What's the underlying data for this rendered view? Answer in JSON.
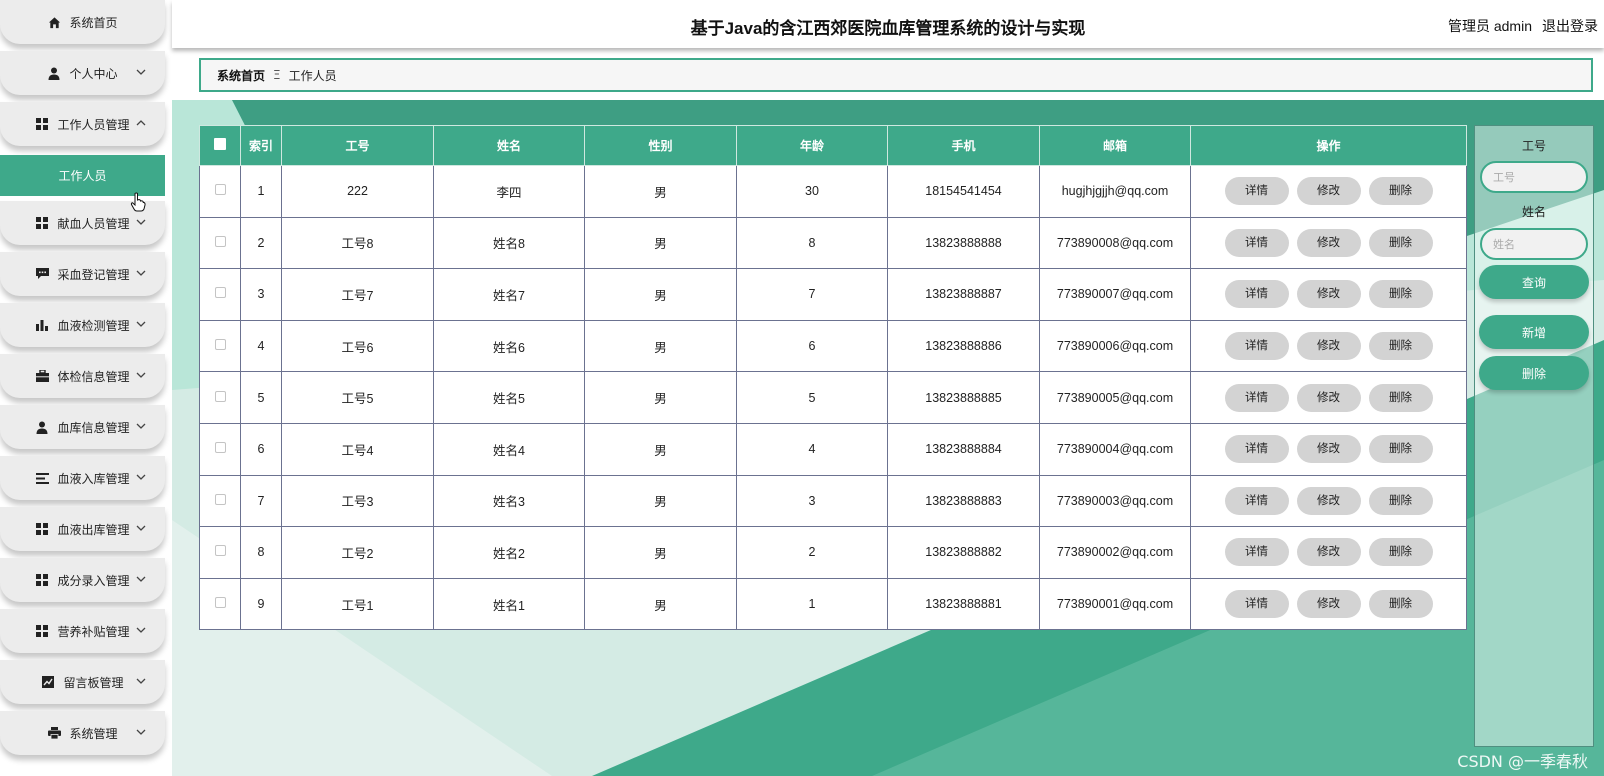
{
  "app": {
    "title": "基于Java的含江西郊医院血库管理系统的设计与实现",
    "user_label": "管理员 admin",
    "logout_label": "退出登录"
  },
  "sidebar": {
    "items": [
      {
        "label": "系统首页",
        "icon": "home-icon"
      },
      {
        "label": "个人中心",
        "icon": "person-icon"
      },
      {
        "label": "工作人员管理",
        "icon": "grid-icon"
      },
      {
        "label": "献血人员管理",
        "icon": "grid-icon"
      },
      {
        "label": "采血登记管理",
        "icon": "chat-icon"
      },
      {
        "label": "血液检测管理",
        "icon": "bar-chart-icon"
      },
      {
        "label": "体检信息管理",
        "icon": "briefcase-icon"
      },
      {
        "label": "血库信息管理",
        "icon": "person-icon"
      },
      {
        "label": "血液入库管理",
        "icon": "list-icon"
      },
      {
        "label": "血液出库管理",
        "icon": "grid-icon"
      },
      {
        "label": "成分录入管理",
        "icon": "grid-icon"
      },
      {
        "label": "营养补贴管理",
        "icon": "grid-icon"
      },
      {
        "label": "留言板管理",
        "icon": "trend-icon"
      },
      {
        "label": "系统管理",
        "icon": "printer-icon"
      }
    ],
    "active_sub_item": "工作人员"
  },
  "breadcrumb": {
    "home": "系统首页",
    "separator": "Ξ",
    "current": "工作人员"
  },
  "table": {
    "columns": [
      "索引",
      "工号",
      "姓名",
      "性别",
      "年龄",
      "手机",
      "邮箱",
      "操作"
    ],
    "action_labels": {
      "detail": "详情",
      "edit": "修改",
      "delete": "删除"
    },
    "rows": [
      {
        "index": "1",
        "staff_no": "222",
        "name": "李四",
        "gender": "男",
        "age": "30",
        "phone": "18154541454",
        "email": "hugjhjgjjh@qq.com"
      },
      {
        "index": "2",
        "staff_no": "工号8",
        "name": "姓名8",
        "gender": "男",
        "age": "8",
        "phone": "13823888888",
        "email": "773890008@qq.com"
      },
      {
        "index": "3",
        "staff_no": "工号7",
        "name": "姓名7",
        "gender": "男",
        "age": "7",
        "phone": "13823888887",
        "email": "773890007@qq.com"
      },
      {
        "index": "4",
        "staff_no": "工号6",
        "name": "姓名6",
        "gender": "男",
        "age": "6",
        "phone": "13823888886",
        "email": "773890006@qq.com"
      },
      {
        "index": "5",
        "staff_no": "工号5",
        "name": "姓名5",
        "gender": "男",
        "age": "5",
        "phone": "13823888885",
        "email": "773890005@qq.com"
      },
      {
        "index": "6",
        "staff_no": "工号4",
        "name": "姓名4",
        "gender": "男",
        "age": "4",
        "phone": "13823888884",
        "email": "773890004@qq.com"
      },
      {
        "index": "7",
        "staff_no": "工号3",
        "name": "姓名3",
        "gender": "男",
        "age": "3",
        "phone": "13823888883",
        "email": "773890003@qq.com"
      },
      {
        "index": "8",
        "staff_no": "工号2",
        "name": "姓名2",
        "gender": "男",
        "age": "2",
        "phone": "13823888882",
        "email": "773890002@qq.com"
      },
      {
        "index": "9",
        "staff_no": "工号1",
        "name": "姓名1",
        "gender": "男",
        "age": "1",
        "phone": "13823888881",
        "email": "773890001@qq.com"
      }
    ]
  },
  "search": {
    "staff_no_label": "工号",
    "staff_no_placeholder": "工号",
    "name_label": "姓名",
    "name_placeholder": "姓名",
    "query_label": "查询",
    "add_label": "新增",
    "delete_label": "删除"
  },
  "watermark": "CSDN @一季春秋",
  "colors": {
    "accent": "#3ea98a",
    "sidebar_item": "#ececec",
    "action_button": "#d3d3d3"
  }
}
